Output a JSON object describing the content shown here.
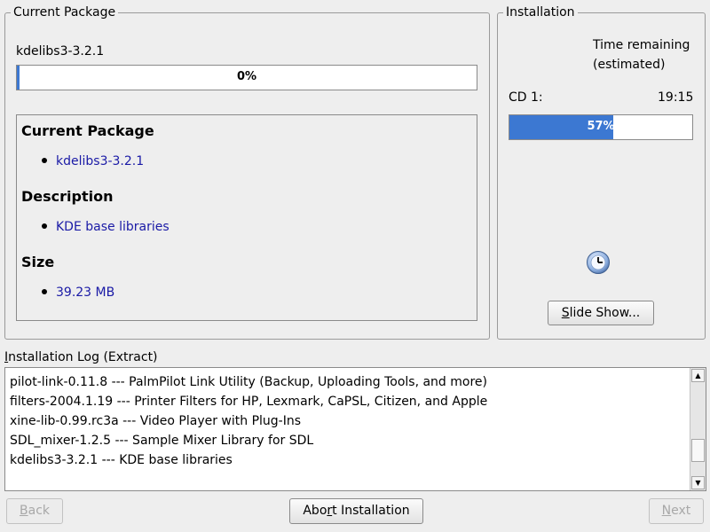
{
  "current_package": {
    "group_title": "Current Package",
    "package_name": "kdelibs3-3.2.1",
    "progress": {
      "percent_label": "0%",
      "value": 0.005
    },
    "details": {
      "heading_package": "Current Package",
      "package": "kdelibs3-3.2.1",
      "heading_description": "Description",
      "description": "KDE base libraries",
      "heading_size": "Size",
      "size": "39.23 MB"
    }
  },
  "installation": {
    "group_title": "Installation",
    "time_remaining_line1": "Time remaining",
    "time_remaining_line2": "(estimated)",
    "cd_label": "CD 1:",
    "cd_time": "19:15",
    "progress": {
      "percent_label": "57%",
      "value": 0.57
    },
    "slideshow_button": "Slide Show...",
    "slideshow_mnemonic": "S",
    "slideshow_rest": "lide Show..."
  },
  "log": {
    "label": "Installation Log (Extract)",
    "label_mnemonic": "I",
    "label_rest": "nstallation Log (Extract)",
    "lines": [
      "pilot-link-0.11.8 --- PalmPilot Link Utility (Backup, Uploading Tools, and more)",
      "filters-2004.1.19 --- Printer Filters for HP, Lexmark, CaPSL, Citizen, and Apple",
      "xine-lib-0.99.rc3a --- Video Player with Plug-Ins",
      "SDL_mixer-1.2.5 --- Sample Mixer Library for SDL",
      "kdelibs3-3.2.1 --- KDE base libraries"
    ]
  },
  "buttons": {
    "back": "Back",
    "back_mnemonic": "B",
    "back_rest": "ack",
    "abort_pre": "Abo",
    "abort_mnemonic": "r",
    "abort_rest": "t Installation",
    "next": "Next",
    "next_mnemonic": "N",
    "next_rest": "ext"
  },
  "colors": {
    "progress_fill": "#3c78d2",
    "info_text": "#1a1aa6",
    "background": "#eeeeee"
  },
  "icons": {
    "clock": "clock-icon"
  }
}
